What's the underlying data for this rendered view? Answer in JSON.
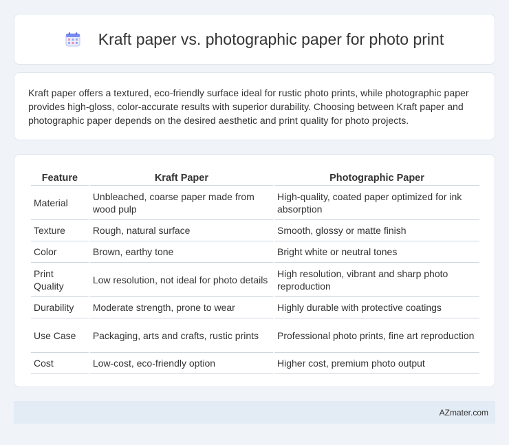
{
  "header": {
    "title": "Kraft paper vs. photographic paper for photo print",
    "icon": "calendar-icon"
  },
  "intro": {
    "text": "Kraft paper offers a textured, eco-friendly surface ideal for rustic photo prints, while photographic paper provides high-gloss, color-accurate results with superior durability. Choosing between Kraft paper and photographic paper depends on the desired aesthetic and print quality for photo projects."
  },
  "table": {
    "headers": [
      "Feature",
      "Kraft Paper",
      "Photographic Paper"
    ],
    "rows": [
      [
        "Material",
        "Unbleached, coarse paper made from wood pulp",
        "High-quality, coated paper optimized for ink absorption"
      ],
      [
        "Texture",
        "Rough, natural surface",
        "Smooth, glossy or matte finish"
      ],
      [
        "Color",
        "Brown, earthy tone",
        "Bright white or neutral tones"
      ],
      [
        "Print Quality",
        "Low resolution, not ideal for photo details",
        "High resolution, vibrant and sharp photo reproduction"
      ],
      [
        "Durability",
        "Moderate strength, prone to wear",
        "Highly durable with protective coatings"
      ],
      [
        "Use Case",
        "Packaging, arts and crafts, rustic prints",
        "Professional photo prints, fine art reproduction"
      ],
      [
        "Cost",
        "Low-cost, eco-friendly option",
        "Higher cost, premium photo output"
      ]
    ]
  },
  "footer": {
    "brand": "AZmater.com"
  },
  "colors": {
    "background": "#f0f4f9",
    "card": "#ffffff",
    "footer": "#e3ebf5",
    "icon_accent": "#7b8cf0"
  }
}
